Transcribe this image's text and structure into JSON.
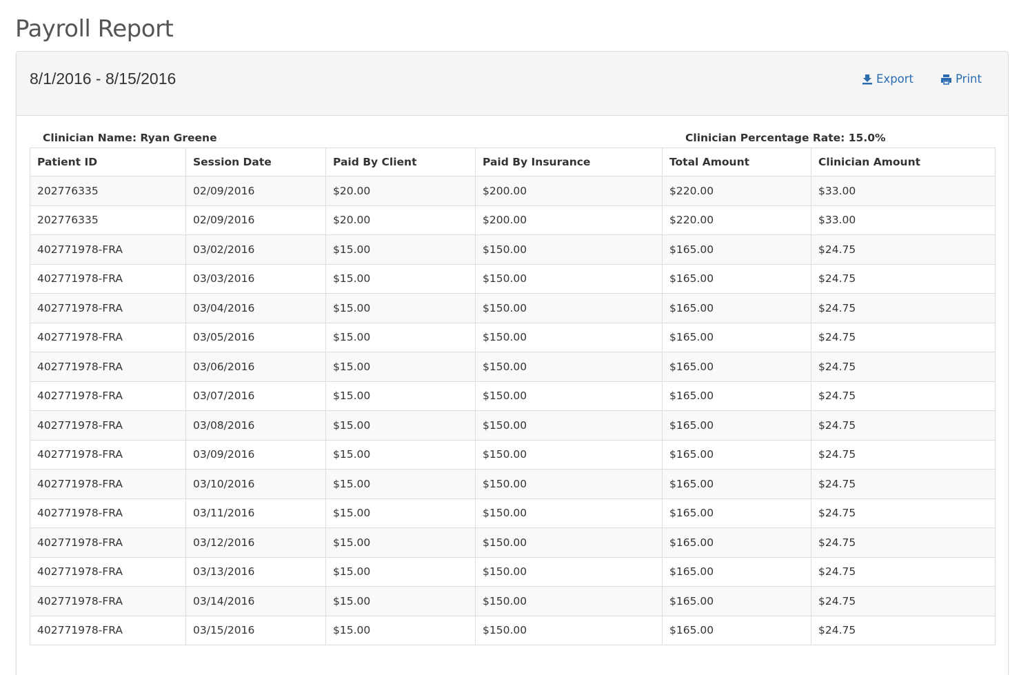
{
  "page": {
    "title": "Payroll Report"
  },
  "panel": {
    "date_range": "8/1/2016 - 8/15/2016",
    "export_label": "Export",
    "print_label": "Print",
    "export_icon": "download-icon",
    "print_icon": "printer-icon",
    "link_color": "#2b6cb0"
  },
  "clinician": {
    "name_text": "Clinician Name: Ryan Greene",
    "rate_text": "Clinician Percentage Rate: 15.0%"
  },
  "table": {
    "headers": [
      "Patient ID",
      "Session Date",
      "Paid By Client",
      "Paid By Insurance",
      "Total Amount",
      "Clinician Amount"
    ],
    "rows": [
      [
        "202776335",
        "02/09/2016",
        "$20.00",
        "$200.00",
        "$220.00",
        "$33.00"
      ],
      [
        "202776335",
        "02/09/2016",
        "$20.00",
        "$200.00",
        "$220.00",
        "$33.00"
      ],
      [
        "402771978-FRA",
        "03/02/2016",
        "$15.00",
        "$150.00",
        "$165.00",
        "$24.75"
      ],
      [
        "402771978-FRA",
        "03/03/2016",
        "$15.00",
        "$150.00",
        "$165.00",
        "$24.75"
      ],
      [
        "402771978-FRA",
        "03/04/2016",
        "$15.00",
        "$150.00",
        "$165.00",
        "$24.75"
      ],
      [
        "402771978-FRA",
        "03/05/2016",
        "$15.00",
        "$150.00",
        "$165.00",
        "$24.75"
      ],
      [
        "402771978-FRA",
        "03/06/2016",
        "$15.00",
        "$150.00",
        "$165.00",
        "$24.75"
      ],
      [
        "402771978-FRA",
        "03/07/2016",
        "$15.00",
        "$150.00",
        "$165.00",
        "$24.75"
      ],
      [
        "402771978-FRA",
        "03/08/2016",
        "$15.00",
        "$150.00",
        "$165.00",
        "$24.75"
      ],
      [
        "402771978-FRA",
        "03/09/2016",
        "$15.00",
        "$150.00",
        "$165.00",
        "$24.75"
      ],
      [
        "402771978-FRA",
        "03/10/2016",
        "$15.00",
        "$150.00",
        "$165.00",
        "$24.75"
      ],
      [
        "402771978-FRA",
        "03/11/2016",
        "$15.00",
        "$150.00",
        "$165.00",
        "$24.75"
      ],
      [
        "402771978-FRA",
        "03/12/2016",
        "$15.00",
        "$150.00",
        "$165.00",
        "$24.75"
      ],
      [
        "402771978-FRA",
        "03/13/2016",
        "$15.00",
        "$150.00",
        "$165.00",
        "$24.75"
      ],
      [
        "402771978-FRA",
        "03/14/2016",
        "$15.00",
        "$150.00",
        "$165.00",
        "$24.75"
      ],
      [
        "402771978-FRA",
        "03/15/2016",
        "$15.00",
        "$150.00",
        "$165.00",
        "$24.75"
      ]
    ]
  }
}
